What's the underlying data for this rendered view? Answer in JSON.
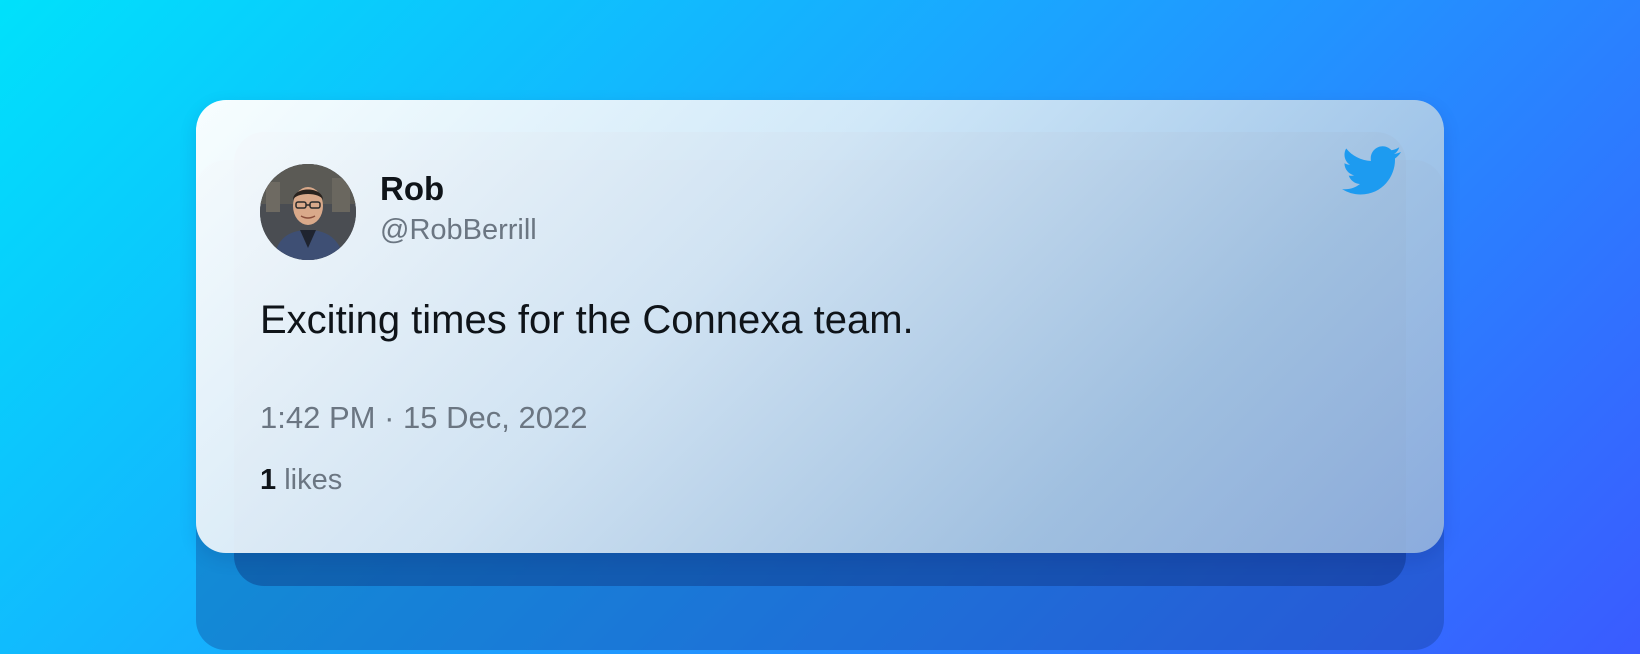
{
  "tweet": {
    "user": {
      "name": "Rob",
      "handle": "@RobBerrill",
      "avatar_icon": "user-photo-avatar"
    },
    "text": "Exciting times for the Connexa team.",
    "time": "1:42 PM",
    "separator": "·",
    "date": "15 Dec, 2022",
    "likes": {
      "count": "1",
      "label": " likes"
    },
    "brand_icon": "twitter-bird-icon"
  },
  "colors": {
    "twitter_blue": "#1d9bf0",
    "background_start": "#00e1fb",
    "background_end": "#3a5bff",
    "text_primary": "#0f1419",
    "text_secondary": "#6b7682"
  }
}
